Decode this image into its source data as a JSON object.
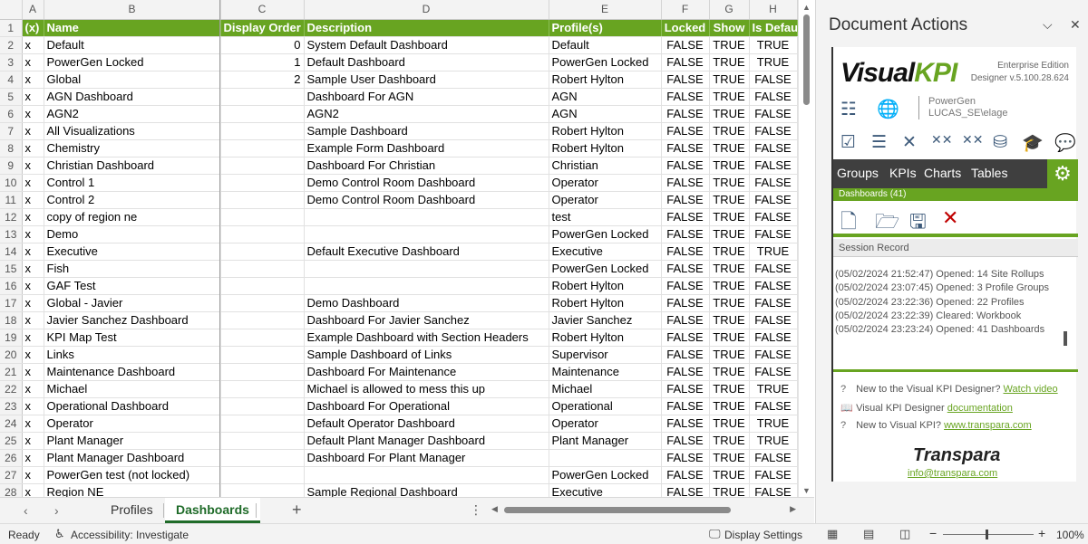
{
  "columns": [
    "A",
    "B",
    "C",
    "D",
    "E",
    "F",
    "G",
    "H"
  ],
  "header": [
    "(x)",
    "Name",
    "Display Order",
    "Description",
    "Profile(s)",
    "Locked",
    "Show",
    "Is Default"
  ],
  "rows": [
    {
      "n": "2",
      "x": "x",
      "name": "Default",
      "order": "0",
      "desc": "System Default Dashboard",
      "profile": "Default",
      "locked": "FALSE",
      "show": "TRUE",
      "def": "TRUE"
    },
    {
      "n": "3",
      "x": "x",
      "name": "PowerGen Locked",
      "order": "1",
      "desc": "Default Dashboard",
      "profile": "PowerGen Locked",
      "locked": "FALSE",
      "show": "TRUE",
      "def": "TRUE"
    },
    {
      "n": "4",
      "x": "x",
      "name": "Global",
      "order": "2",
      "desc": "Sample User Dashboard",
      "profile": "Robert Hylton",
      "locked": "FALSE",
      "show": "TRUE",
      "def": "FALSE"
    },
    {
      "n": "5",
      "x": "x",
      "name": "AGN Dashboard",
      "order": "",
      "desc": "Dashboard For AGN",
      "profile": "AGN",
      "locked": "FALSE",
      "show": "TRUE",
      "def": "FALSE"
    },
    {
      "n": "6",
      "x": "x",
      "name": "AGN2",
      "order": "",
      "desc": "AGN2",
      "profile": "AGN",
      "locked": "FALSE",
      "show": "TRUE",
      "def": "FALSE"
    },
    {
      "n": "7",
      "x": "x",
      "name": "All Visualizations",
      "order": "",
      "desc": "Sample Dashboard",
      "profile": "Robert Hylton",
      "locked": "FALSE",
      "show": "TRUE",
      "def": "FALSE"
    },
    {
      "n": "8",
      "x": "x",
      "name": "Chemistry",
      "order": "",
      "desc": "Example Form Dashboard",
      "profile": "Robert Hylton",
      "locked": "FALSE",
      "show": "TRUE",
      "def": "FALSE"
    },
    {
      "n": "9",
      "x": "x",
      "name": "Christian Dashboard",
      "order": "",
      "desc": "Dashboard For Christian",
      "profile": "Christian",
      "locked": "FALSE",
      "show": "TRUE",
      "def": "FALSE"
    },
    {
      "n": "10",
      "x": "x",
      "name": "Control 1",
      "order": "",
      "desc": "Demo Control Room Dashboard",
      "profile": "Operator",
      "locked": "FALSE",
      "show": "TRUE",
      "def": "FALSE"
    },
    {
      "n": "11",
      "x": "x",
      "name": "Control 2",
      "order": "",
      "desc": "Demo Control Room Dashboard",
      "profile": "Operator",
      "locked": "FALSE",
      "show": "TRUE",
      "def": "FALSE"
    },
    {
      "n": "12",
      "x": "x",
      "name": "copy of region ne",
      "order": "",
      "desc": "",
      "profile": "test",
      "locked": "FALSE",
      "show": "TRUE",
      "def": "FALSE"
    },
    {
      "n": "13",
      "x": "x",
      "name": "Demo",
      "order": "",
      "desc": "",
      "profile": "PowerGen Locked",
      "locked": "FALSE",
      "show": "TRUE",
      "def": "FALSE"
    },
    {
      "n": "14",
      "x": "x",
      "name": "Executive",
      "order": "",
      "desc": "Default Executive Dashboard",
      "profile": "Executive",
      "locked": "FALSE",
      "show": "TRUE",
      "def": "TRUE"
    },
    {
      "n": "15",
      "x": "x",
      "name": "Fish",
      "order": "",
      "desc": "",
      "profile": "PowerGen Locked",
      "locked": "FALSE",
      "show": "TRUE",
      "def": "FALSE"
    },
    {
      "n": "16",
      "x": "x",
      "name": "GAF Test",
      "order": "",
      "desc": "",
      "profile": "Robert Hylton",
      "locked": "FALSE",
      "show": "TRUE",
      "def": "FALSE"
    },
    {
      "n": "17",
      "x": "x",
      "name": "Global - Javier",
      "order": "",
      "desc": "Demo Dashboard",
      "profile": "Robert Hylton",
      "locked": "FALSE",
      "show": "TRUE",
      "def": "FALSE"
    },
    {
      "n": "18",
      "x": "x",
      "name": "Javier Sanchez Dashboard",
      "order": "",
      "desc": "Dashboard For Javier Sanchez",
      "profile": "Javier Sanchez",
      "locked": "FALSE",
      "show": "TRUE",
      "def": "FALSE"
    },
    {
      "n": "19",
      "x": "x",
      "name": "KPI Map Test",
      "order": "",
      "desc": "Example Dashboard with Section Headers",
      "profile": "Robert Hylton",
      "locked": "FALSE",
      "show": "TRUE",
      "def": "FALSE"
    },
    {
      "n": "20",
      "x": "x",
      "name": "Links",
      "order": "",
      "desc": "Sample Dashboard of Links",
      "profile": "Supervisor",
      "locked": "FALSE",
      "show": "TRUE",
      "def": "FALSE"
    },
    {
      "n": "21",
      "x": "x",
      "name": "Maintenance Dashboard",
      "order": "",
      "desc": "Dashboard For Maintenance",
      "profile": "Maintenance",
      "locked": "FALSE",
      "show": "TRUE",
      "def": "FALSE"
    },
    {
      "n": "22",
      "x": "x",
      "name": "Michael",
      "order": "",
      "desc": "Michael is allowed to mess this up",
      "profile": "Michael",
      "locked": "FALSE",
      "show": "TRUE",
      "def": "TRUE"
    },
    {
      "n": "23",
      "x": "x",
      "name": "Operational Dashboard",
      "order": "",
      "desc": "Dashboard For Operational",
      "profile": "Operational",
      "locked": "FALSE",
      "show": "TRUE",
      "def": "FALSE"
    },
    {
      "n": "24",
      "x": "x",
      "name": "Operator",
      "order": "",
      "desc": "Default Operator Dashboard",
      "profile": "Operator",
      "locked": "FALSE",
      "show": "TRUE",
      "def": "TRUE"
    },
    {
      "n": "25",
      "x": "x",
      "name": "Plant Manager",
      "order": "",
      "desc": "Default Plant Manager Dashboard",
      "profile": "Plant Manager",
      "locked": "FALSE",
      "show": "TRUE",
      "def": "TRUE"
    },
    {
      "n": "26",
      "x": "x",
      "name": "Plant Manager Dashboard",
      "order": "",
      "desc": "Dashboard For Plant Manager",
      "profile": "",
      "locked": "FALSE",
      "show": "TRUE",
      "def": "FALSE"
    },
    {
      "n": "27",
      "x": "x",
      "name": "PowerGen test (not locked)",
      "order": "",
      "desc": "",
      "profile": "PowerGen Locked",
      "locked": "FALSE",
      "show": "TRUE",
      "def": "FALSE"
    },
    {
      "n": "28",
      "x": "x",
      "name": "Region NE",
      "order": "",
      "desc": "Sample Regional Dashboard",
      "profile": "Executive",
      "locked": "FALSE",
      "show": "TRUE",
      "def": "FALSE"
    }
  ],
  "sheet_tabs": [
    "Profiles",
    "Dashboards"
  ],
  "active_tab": "Dashboards",
  "status": {
    "ready": "Ready",
    "accessibility": "Accessibility: Investigate",
    "display_settings": "Display Settings",
    "zoom": "100%"
  },
  "pane": {
    "title": "Document Actions",
    "logo_visual": "Visual",
    "logo_kpi": "KPI",
    "edition": "Enterprise Edition",
    "version": "Designer v.5.100.28.624",
    "server": "PowerGen",
    "user": "LUCAS_SE\\elage",
    "nav": [
      "Groups",
      "KPIs",
      "Charts",
      "Tables"
    ],
    "sub_label": "Dashboards (41)",
    "session_title": "Session Record",
    "session_log": [
      "(05/02/2024 21:52:47) Opened: 14 Site Rollups",
      "(05/02/2024 23:07:45) Opened: 3 Profile Groups",
      "(05/02/2024 23:22:36) Opened: 22 Profiles",
      "(05/02/2024 23:22:39) Cleared: Workbook",
      "(05/02/2024 23:23:24) Opened: 41 Dashboards"
    ],
    "help1_text": "New to the Visual KPI Designer?",
    "help1_link": "Watch video",
    "help2_text": "Visual KPI Designer",
    "help2_link": "documentation",
    "help3_text": "New to Visual KPI?",
    "help3_link": "www.transpara.com",
    "brand": "Transpara",
    "email": "info@transpara.com"
  },
  "colors": {
    "accent": "#68a421",
    "dark_nav": "#3f3f3f",
    "excel_green": "#1f6b29"
  }
}
